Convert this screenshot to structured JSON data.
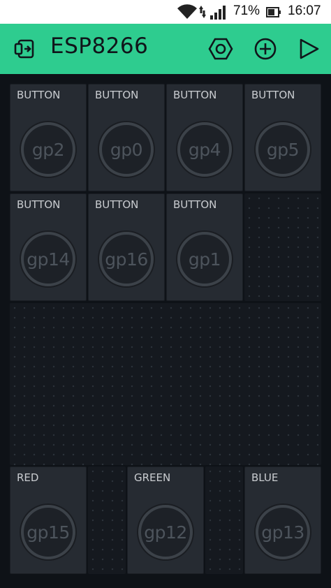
{
  "status_bar": {
    "battery_percent": "71%",
    "time": "16:07"
  },
  "app_bar": {
    "title": "ESP8266",
    "icons": [
      "device-icon",
      "settings-hex-icon",
      "add-icon",
      "play-icon"
    ]
  },
  "widgets": [
    {
      "label": "BUTTON",
      "pin": "gp2"
    },
    {
      "label": "BUTTON",
      "pin": "gp0"
    },
    {
      "label": "BUTTON",
      "pin": "gp4"
    },
    {
      "label": "BUTTON",
      "pin": "gp5"
    },
    {
      "label": "BUTTON",
      "pin": "gp14"
    },
    {
      "label": "BUTTON",
      "pin": "gp16"
    },
    {
      "label": "BUTTON",
      "pin": "gp1"
    },
    {
      "label": "RED",
      "pin": "gp15"
    },
    {
      "label": "GREEN",
      "pin": "gp12"
    },
    {
      "label": "BLUE",
      "pin": "gp13"
    }
  ],
  "colors": {
    "app_bar": "#2ecc8f",
    "background": "#0e1217",
    "widget": "#262b32"
  }
}
